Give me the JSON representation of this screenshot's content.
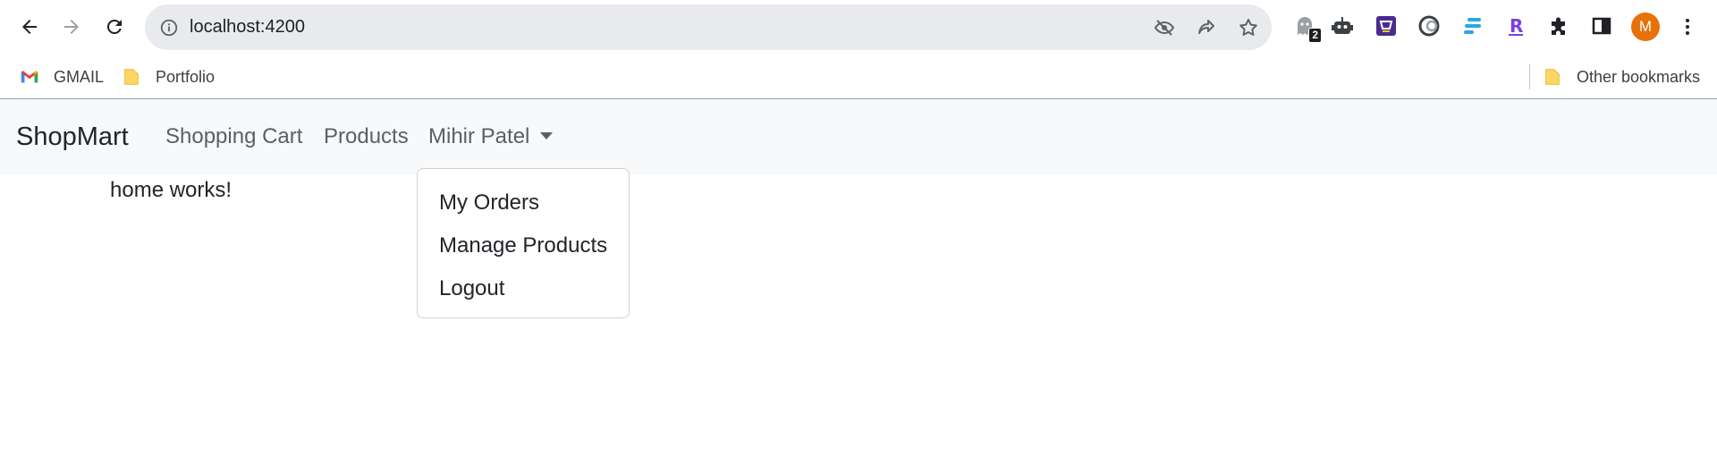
{
  "browser": {
    "url": "localhost:4200",
    "extensions": [
      {
        "icon": "ghostery-icon",
        "badge": "2"
      },
      {
        "icon": "robot-icon"
      },
      {
        "icon": "shopping-extension-icon"
      },
      {
        "icon": "swirl-extension-icon"
      },
      {
        "icon": "stripes-extension-icon"
      },
      {
        "icon": "r-extension-icon"
      },
      {
        "icon": "puzzle-icon"
      },
      {
        "icon": "side-panel-icon"
      }
    ],
    "profile_initial": "M",
    "profile_color": "#e8710a",
    "bookmarks": [
      {
        "label": "GMAIL",
        "icon": "gmail-icon"
      },
      {
        "label": "Portfolio",
        "icon": "folder-icon"
      }
    ],
    "other_bookmarks": "Other bookmarks"
  },
  "navbar": {
    "brand": "ShopMart",
    "links": [
      "Shopping Cart",
      "Products"
    ],
    "user_menu": "Mihir Patel"
  },
  "dropdown": {
    "items": [
      "My Orders",
      "Manage Products",
      "Logout"
    ]
  },
  "content": {
    "text": "home works!"
  }
}
